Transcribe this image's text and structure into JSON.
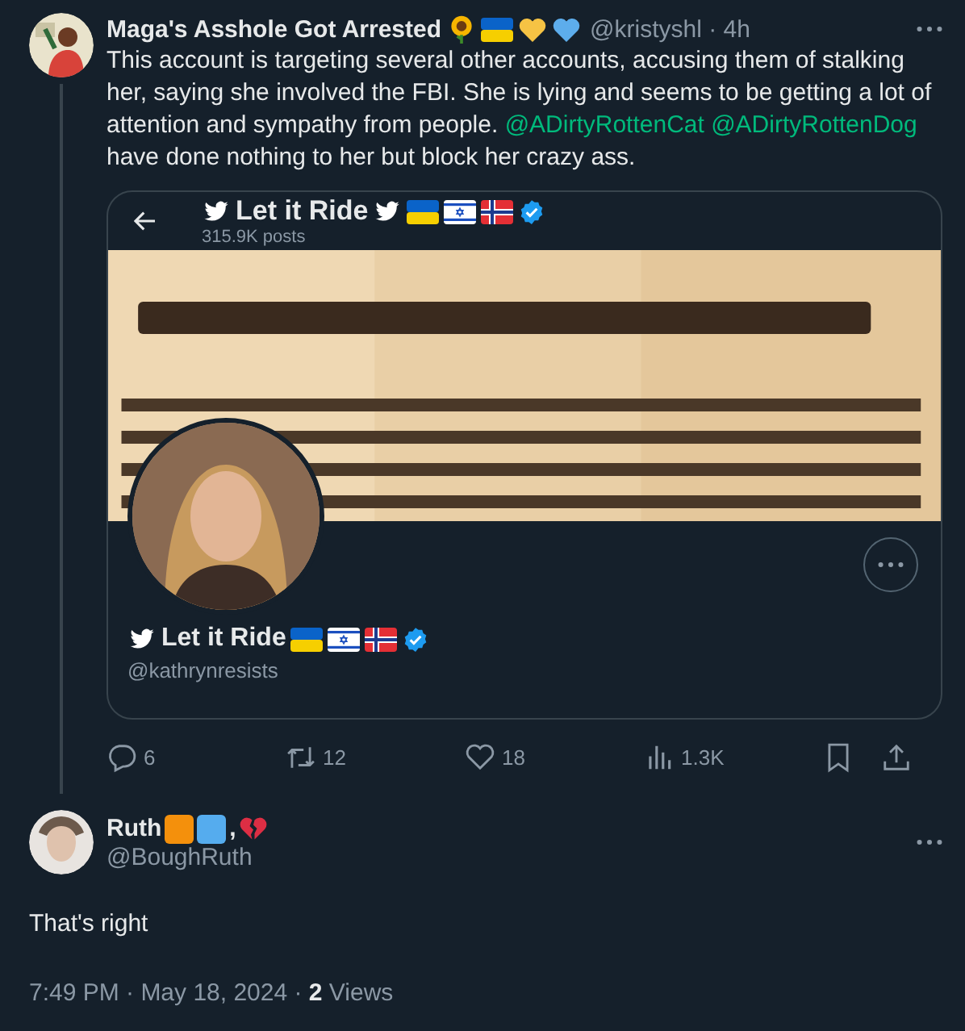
{
  "tweet": {
    "author": {
      "name": "Maga's Asshole Got Arrested",
      "meta": "@kristyshl · 4h"
    },
    "body": [
      {
        "kind": "text",
        "text": "This account is targeting several other accounts, accusing them of stalking her, saying she involved the FBI. She is lying and seems to be getting a lot of attention and sympathy from people. "
      },
      {
        "kind": "mention",
        "text": "@ADirtyRottenCat "
      },
      {
        "kind": "mention",
        "text": "@ADirtyRottenDog"
      },
      {
        "kind": "text",
        "text": " have done nothing to her but block her crazy ass."
      }
    ],
    "quoted_profile": {
      "title": "Let it Ride",
      "posts": "315.9K posts",
      "name": "Let it Ride",
      "handle": "@kathrynresists"
    },
    "actions": [
      {
        "kind": "reply",
        "count": "6"
      },
      {
        "kind": "repost",
        "count": "12"
      },
      {
        "kind": "like",
        "count": "18"
      },
      {
        "kind": "views",
        "count": "1.3K"
      },
      {
        "kind": "bookmark"
      },
      {
        "kind": "share"
      }
    ]
  },
  "reply": {
    "name": "Ruth",
    "name_suffix": ",",
    "handle": "@BoughRuth",
    "body": "That's right",
    "footer": "7:49 PM · May 18, 2024 · **2** Views"
  }
}
